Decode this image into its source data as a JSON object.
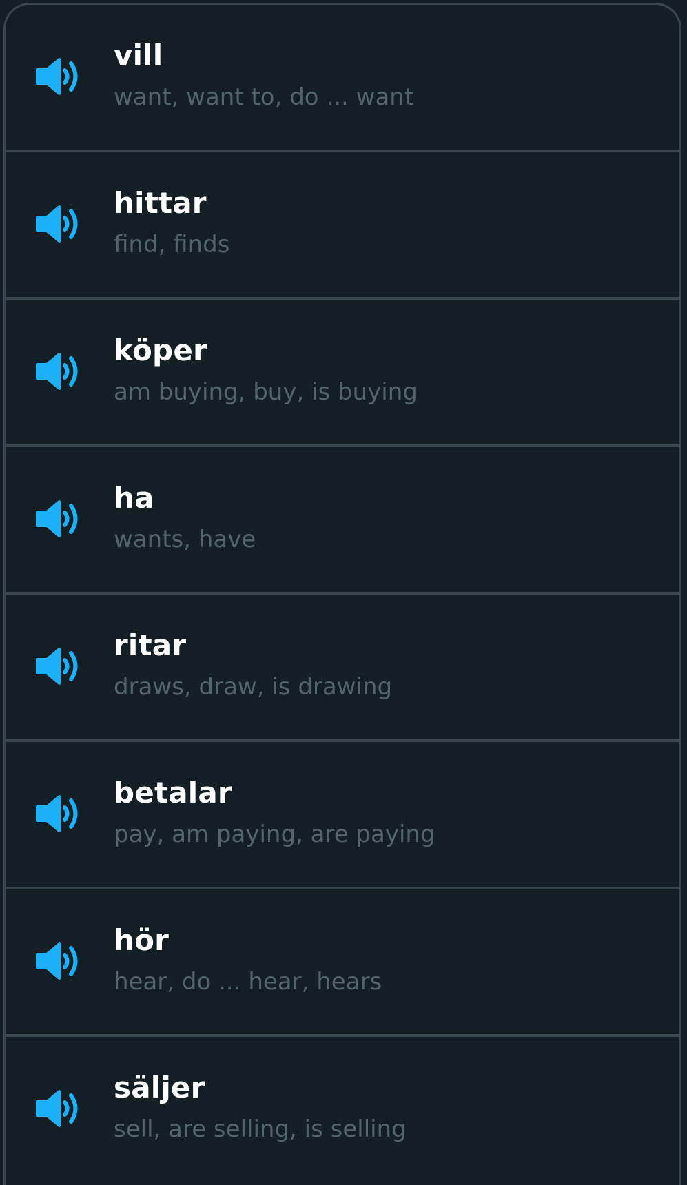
{
  "accent_color": "#1cb0f6",
  "words": [
    {
      "word": "vill",
      "translation": "want, want to, do ... want",
      "icon": "speaker-icon"
    },
    {
      "word": "hittar",
      "translation": "find, finds",
      "icon": "speaker-icon"
    },
    {
      "word": "köper",
      "translation": "am buying, buy, is buying",
      "icon": "speaker-icon"
    },
    {
      "word": "ha",
      "translation": "wants, have",
      "icon": "speaker-icon"
    },
    {
      "word": "ritar",
      "translation": "draws, draw, is drawing",
      "icon": "speaker-icon"
    },
    {
      "word": "betalar",
      "translation": "pay, am paying, are paying",
      "icon": "speaker-icon"
    },
    {
      "word": "hör",
      "translation": "hear, do ... hear, hears",
      "icon": "speaker-icon"
    },
    {
      "word": "säljer",
      "translation": "sell, are selling, is selling",
      "icon": "speaker-icon"
    }
  ]
}
